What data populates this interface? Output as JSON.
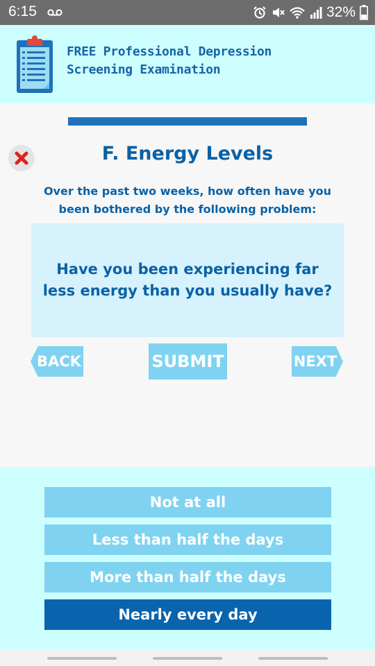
{
  "status_bar": {
    "time": "6:15",
    "battery_percent": "32%",
    "icons": [
      "voicemail-icon",
      "alarm-icon",
      "mute-icon",
      "wifi-icon",
      "signal-icon",
      "battery-icon"
    ]
  },
  "header": {
    "title": "FREE Professional Depression Screening Examination",
    "icon": "clipboard-icon"
  },
  "progress": {
    "fraction": 1.0
  },
  "question_card": {
    "close_icon": "close-icon",
    "section_title": "F. Energy Levels",
    "prompt": "Over the past two weeks, how often have you been bothered by the following problem:",
    "question": "Have you been experiencing far less energy than you usually have?"
  },
  "navigation": {
    "back_label": "BACK",
    "submit_label": "SUBMIT",
    "next_label": "NEXT"
  },
  "answers": [
    {
      "label": "Not at all",
      "selected": false
    },
    {
      "label": "Less than half the days",
      "selected": false
    },
    {
      "label": "More than half the days",
      "selected": false
    },
    {
      "label": "Nearly every day",
      "selected": true
    }
  ],
  "colors": {
    "header_bg": "#ceffff",
    "primary_blue": "#0a63ad",
    "light_blue": "#7fd3f1",
    "question_bg": "#d6f2fc"
  }
}
